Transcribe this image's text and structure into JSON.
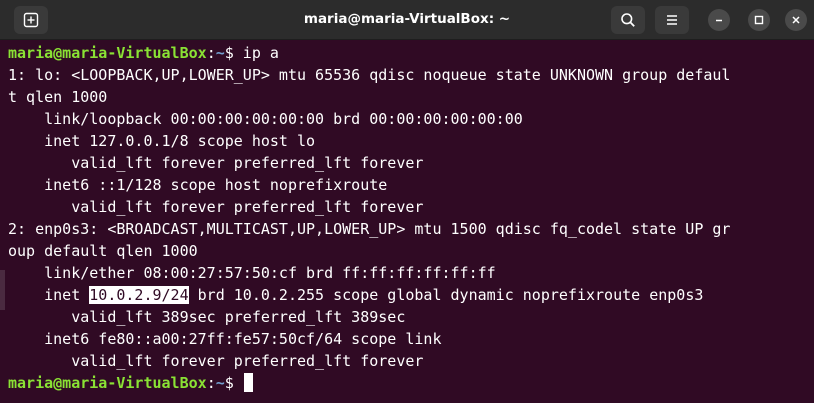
{
  "window": {
    "title": "maria@maria-VirtualBox: ~",
    "buttons": {
      "new_tab_icon": "new-tab-icon",
      "search_icon": "search-icon",
      "menu_icon": "hamburger-menu-icon",
      "minimize_icon": "minimize-icon",
      "maximize_icon": "maximize-icon",
      "close_icon": "close-icon"
    }
  },
  "terminal": {
    "prompt_user": "maria@maria-VirtualBox",
    "prompt_sep": ":",
    "prompt_path": "~",
    "prompt_symbol": "$",
    "command": " ip a",
    "output": [
      "1: lo: <LOOPBACK,UP,LOWER_UP> mtu 65536 qdisc noqueue state UNKNOWN group defaul",
      "t qlen 1000",
      "    link/loopback 00:00:00:00:00:00 brd 00:00:00:00:00:00",
      "    inet 127.0.0.1/8 scope host lo",
      "       valid_lft forever preferred_lft forever",
      "    inet6 ::1/128 scope host noprefixroute",
      "       valid_lft forever preferred_lft forever",
      "2: enp0s3: <BROADCAST,MULTICAST,UP,LOWER_UP> mtu 1500 qdisc fq_codel state UP gr",
      "oup default qlen 1000",
      "    link/ether 08:00:27:57:50:cf brd ff:ff:ff:ff:ff:ff"
    ],
    "inet_line": {
      "before": "    inet ",
      "highlight": "10.0.2.9/24",
      "after": " brd 10.0.2.255 scope global dynamic noprefixroute enp0s3"
    },
    "output_tail": [
      "       valid_lft 389sec preferred_lft 389sec",
      "    inet6 fe80::a00:27ff:fe57:50cf/64 scope link",
      "       valid_lft forever preferred_lft forever"
    ],
    "colors": {
      "background": "#300a24",
      "user": "#8ae234",
      "path": "#729fcf",
      "text": "#ffffff"
    }
  }
}
